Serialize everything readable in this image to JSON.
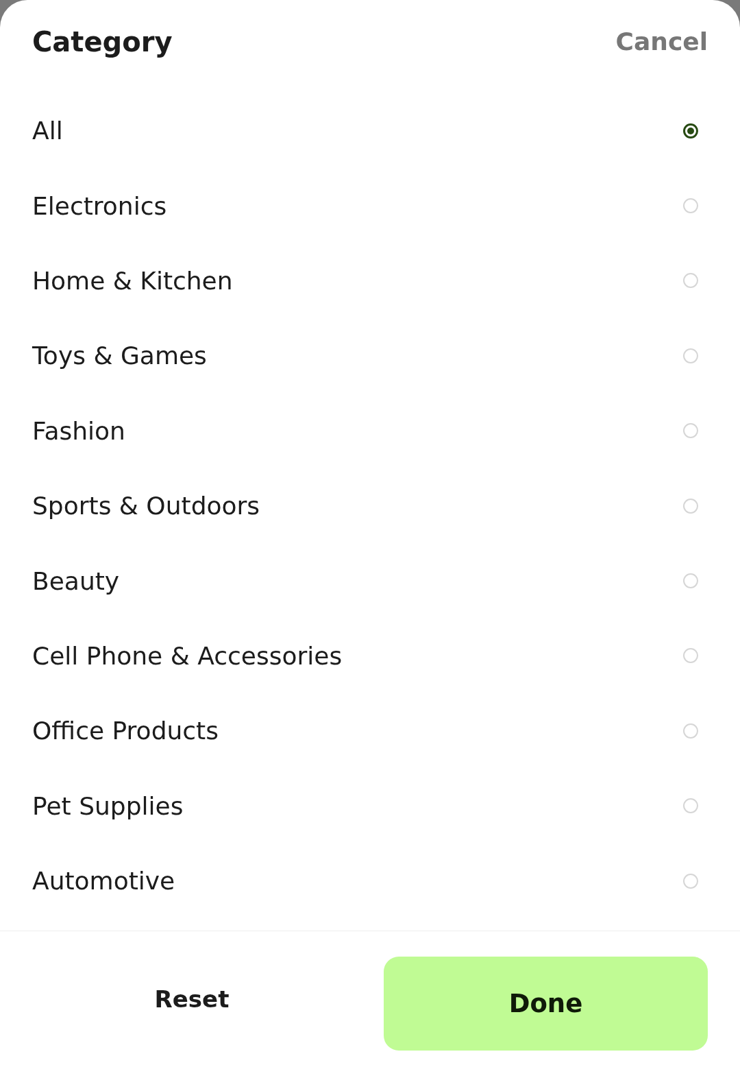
{
  "header": {
    "title": "Category",
    "cancel": "Cancel"
  },
  "options": [
    {
      "label": "All",
      "selected": true
    },
    {
      "label": "Electronics",
      "selected": false
    },
    {
      "label": "Home & Kitchen",
      "selected": false
    },
    {
      "label": "Toys & Games",
      "selected": false
    },
    {
      "label": "Fashion",
      "selected": false
    },
    {
      "label": "Sports & Outdoors",
      "selected": false
    },
    {
      "label": "Beauty",
      "selected": false
    },
    {
      "label": "Cell Phone & Accessories",
      "selected": false
    },
    {
      "label": "Office Products",
      "selected": false
    },
    {
      "label": "Pet Supplies",
      "selected": false
    },
    {
      "label": "Automotive",
      "selected": false
    }
  ],
  "footer": {
    "reset": "Reset",
    "done": "Done"
  }
}
